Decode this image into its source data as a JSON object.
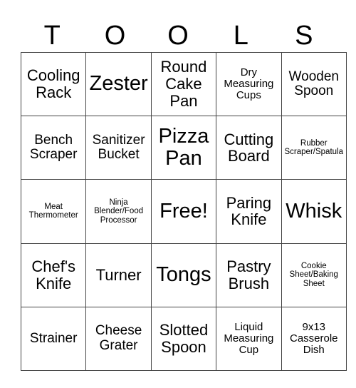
{
  "title_letters": [
    "T",
    "O",
    "O",
    "L",
    "S"
  ],
  "rows": [
    [
      {
        "text": "Cooling Rack",
        "size": "l"
      },
      {
        "text": "Zester",
        "size": "xl"
      },
      {
        "text": "Round Cake Pan",
        "size": "l"
      },
      {
        "text": "Dry Measuring Cups",
        "size": "s"
      },
      {
        "text": "Wooden Spoon",
        "size": "m"
      }
    ],
    [
      {
        "text": "Bench Scraper",
        "size": "m"
      },
      {
        "text": "Sanitizer Bucket",
        "size": "m"
      },
      {
        "text": "Pizza Pan",
        "size": "xl"
      },
      {
        "text": "Cutting Board",
        "size": "l"
      },
      {
        "text": "Rubber Scraper/Spatula",
        "size": "xs"
      }
    ],
    [
      {
        "text": "Meat Thermometer",
        "size": "xs"
      },
      {
        "text": "Ninja Blender/Food Processor",
        "size": "xs"
      },
      {
        "text": "Free!",
        "size": "xl"
      },
      {
        "text": "Paring Knife",
        "size": "l"
      },
      {
        "text": "Whisk",
        "size": "xl"
      }
    ],
    [
      {
        "text": "Chef's Knife",
        "size": "l"
      },
      {
        "text": "Turner",
        "size": "l"
      },
      {
        "text": "Tongs",
        "size": "xl"
      },
      {
        "text": "Pastry Brush",
        "size": "l"
      },
      {
        "text": "Cookie Sheet/Baking Sheet",
        "size": "xs"
      }
    ],
    [
      {
        "text": "Strainer",
        "size": "m"
      },
      {
        "text": "Cheese Grater",
        "size": "m"
      },
      {
        "text": "Slotted Spoon",
        "size": "l"
      },
      {
        "text": "Liquid Measuring Cup",
        "size": "s"
      },
      {
        "text": "9x13 Casserole Dish",
        "size": "s"
      }
    ]
  ]
}
